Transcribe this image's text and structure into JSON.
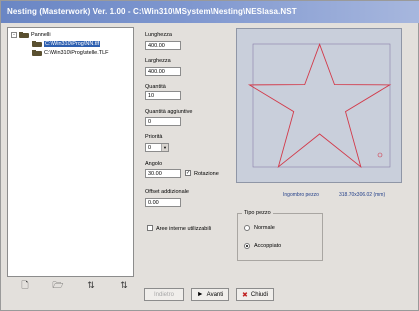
{
  "window": {
    "title": "Nesting (Masterwork) Ver. 1.00 - C:\\Win310\\MSystem\\Nesting\\NESlasa.NST"
  },
  "tree": {
    "root_label": "Pannelli",
    "root_expander": "-",
    "items": [
      {
        "label": "C:\\Win310\\Prog\\NN.tlf"
      },
      {
        "label": "C:\\Win310\\Prog\\stelle.TLF"
      }
    ]
  },
  "tree_toolbar": [
    {
      "icon": "new-file-icon",
      "glyph": "🗋"
    },
    {
      "icon": "open-folder-icon",
      "glyph": "🗁"
    },
    {
      "icon": "sort-icon",
      "glyph": "⇅"
    },
    {
      "icon": "sort-alt-icon",
      "glyph": "⇅"
    }
  ],
  "form": {
    "lunghezza": {
      "label": "Lunghezza",
      "value": "400.00"
    },
    "larghezza": {
      "label": "Larghezza",
      "value": "400.00"
    },
    "quantita": {
      "label": "Quantità",
      "value": "10"
    },
    "quantita_agg": {
      "label": "Quantità aggiuntive",
      "value": "0"
    },
    "priorita": {
      "label": "Priorità",
      "value": "0"
    },
    "angolo": {
      "label": "Angolo",
      "value": "30.00"
    },
    "rotazione": {
      "label": "Rotazione",
      "checked": true
    },
    "offset": {
      "label": "Offset addizionale",
      "value": "0.00"
    },
    "aree_interne": {
      "label": "Aree interne utilizzabili",
      "checked": false
    }
  },
  "preview": {
    "info_label": "Ingombro pezzo",
    "info_value": "318.70x306.02 (mm)",
    "shape_color": "#d23a4a"
  },
  "tipo_pezzo": {
    "title": "Tipo pezzo",
    "options": [
      {
        "label": "Normale",
        "selected": false
      },
      {
        "label": "Accoppiato",
        "selected": true
      }
    ]
  },
  "buttons": {
    "disabled": {
      "label": "Indietro"
    },
    "next": {
      "label": "Avanti",
      "icon": "►"
    },
    "close": {
      "label": "Chiudi",
      "icon": "✖"
    }
  }
}
